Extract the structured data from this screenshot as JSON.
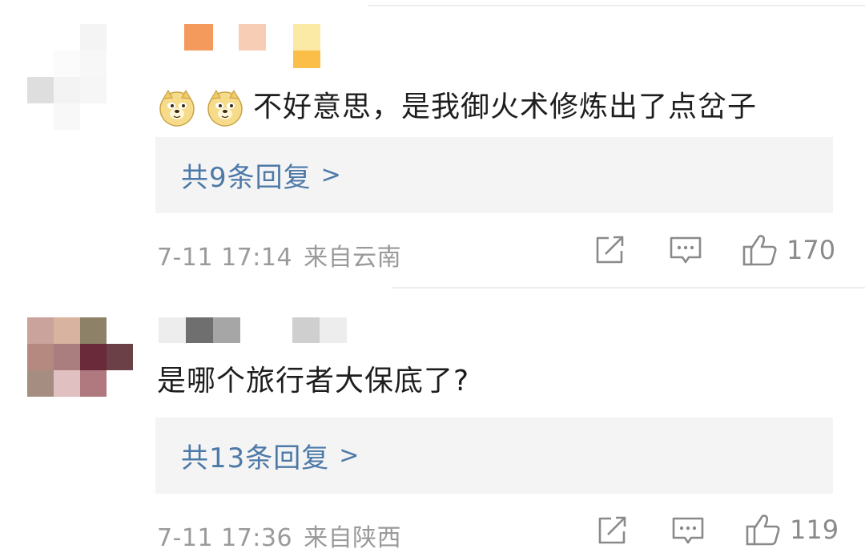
{
  "comments": [
    {
      "text": "不好意思，是我御火术修炼出了点岔子",
      "emoji_count": 2,
      "emoji_icon": "doge-emoji-icon",
      "reply_label": "共9条回复",
      "reply_chevron": ">",
      "time": "7-11 17:14",
      "location": "来自云南",
      "likes": "170"
    },
    {
      "text": "是哪个旅行者大保底了?",
      "reply_label": "共13条回复",
      "reply_chevron": ">",
      "time": "7-11 17:36",
      "location": "来自陕西",
      "likes": "119"
    }
  ],
  "icons": {
    "share": "share-icon",
    "comment": "comment-icon",
    "like": "thumbs-up-icon"
  },
  "colors": {
    "link_blue": "#4d79a8",
    "meta_gray": "#9a9a9a",
    "reply_bg": "#f4f4f4",
    "text": "#1e1e1e"
  }
}
